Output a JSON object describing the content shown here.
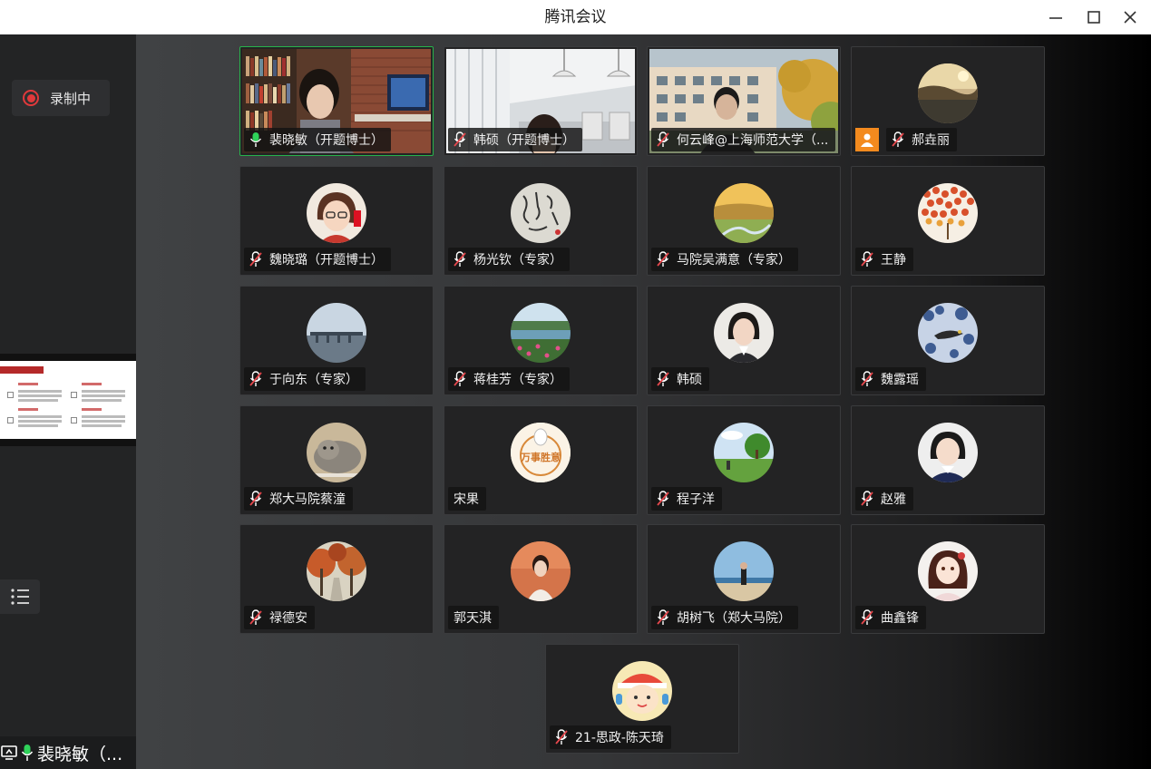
{
  "window": {
    "title": "腾讯会议"
  },
  "sidebar": {
    "recording_label": "录制中",
    "self_name": "裴晓敏（..."
  },
  "participants": [
    {
      "name": "裴晓敏（开题博士）",
      "mic": "active",
      "kind": "video",
      "scene": "bookshelf"
    },
    {
      "name": "韩硕（开题博士）",
      "mic": "muted",
      "kind": "video",
      "scene": "office"
    },
    {
      "name": "何云峰@上海师范大学（...",
      "mic": "muted",
      "kind": "video",
      "scene": "outdoor"
    },
    {
      "name": "郝垚丽",
      "mic": "muted",
      "kind": "avatar",
      "avatar": "sunset",
      "badge": "person-icon"
    },
    {
      "name": "魏晓璐（开题博士）",
      "mic": "muted",
      "kind": "avatar",
      "avatar": "cartoon-girl"
    },
    {
      "name": "杨光钦（专家）",
      "mic": "muted",
      "kind": "avatar",
      "avatar": "calligraphy"
    },
    {
      "name": "马院吴满意（专家）",
      "mic": "muted",
      "kind": "avatar",
      "avatar": "grassland"
    },
    {
      "name": "王静",
      "mic": "muted",
      "kind": "avatar",
      "avatar": "red-dots"
    },
    {
      "name": "于向东（专家）",
      "mic": "muted",
      "kind": "avatar",
      "avatar": "bridge"
    },
    {
      "name": "蒋桂芳（专家）",
      "mic": "muted",
      "kind": "avatar",
      "avatar": "flowers"
    },
    {
      "name": "韩硕",
      "mic": "muted",
      "kind": "avatar",
      "avatar": "portrait-woman"
    },
    {
      "name": "魏露瑶",
      "mic": "muted",
      "kind": "avatar",
      "avatar": "bird-painting"
    },
    {
      "name": "郑大马院蔡潼",
      "mic": "muted",
      "kind": "avatar",
      "avatar": "cat"
    },
    {
      "name": "宋果",
      "mic": "none",
      "kind": "avatar",
      "avatar": "wanshi-badge",
      "avatar_text": "万事胜意"
    },
    {
      "name": "程子洋",
      "mic": "muted",
      "kind": "avatar",
      "avatar": "tree-sky"
    },
    {
      "name": "赵雅",
      "mic": "muted",
      "kind": "avatar",
      "avatar": "child-portrait"
    },
    {
      "name": "禄德安",
      "mic": "muted",
      "kind": "avatar",
      "avatar": "autumn-trees"
    },
    {
      "name": "郭天淇",
      "mic": "none",
      "kind": "avatar",
      "avatar": "girl-orange"
    },
    {
      "name": "胡树飞（郑大马院）",
      "mic": "muted",
      "kind": "avatar",
      "avatar": "beach"
    },
    {
      "name": "曲鑫锋",
      "mic": "muted",
      "kind": "avatar",
      "avatar": "anime-girl"
    },
    {
      "name": "21-思政-陈天琦",
      "mic": "muted",
      "kind": "avatar",
      "avatar": "cartoon-kid"
    }
  ],
  "colors": {
    "accent_green": "#27b34b",
    "record_red": "#e0393b",
    "muted_red": "#e5484d",
    "badge_orange": "#f38a1e"
  }
}
